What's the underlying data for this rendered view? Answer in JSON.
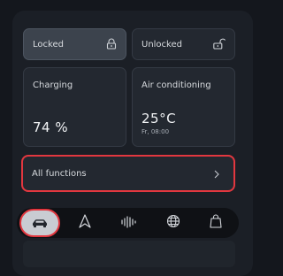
{
  "lock": {
    "locked_label": "Locked",
    "unlocked_label": "Unlocked"
  },
  "charging": {
    "title": "Charging",
    "value": "74 %"
  },
  "climate": {
    "title": "Air conditioning",
    "value": "25°C",
    "schedule": "Fr, 08:00"
  },
  "functions": {
    "label": "All functions"
  },
  "nav": {
    "items": [
      {
        "icon": "car-icon",
        "active": true
      },
      {
        "icon": "navigation-arrow-icon",
        "active": false
      },
      {
        "icon": "audio-waveform-icon",
        "active": false
      },
      {
        "icon": "globe-icon",
        "active": false
      },
      {
        "icon": "shopping-bag-icon",
        "active": false
      }
    ]
  },
  "colors": {
    "highlight": "#e2373f",
    "background": "#14171d",
    "card": "#232830"
  }
}
